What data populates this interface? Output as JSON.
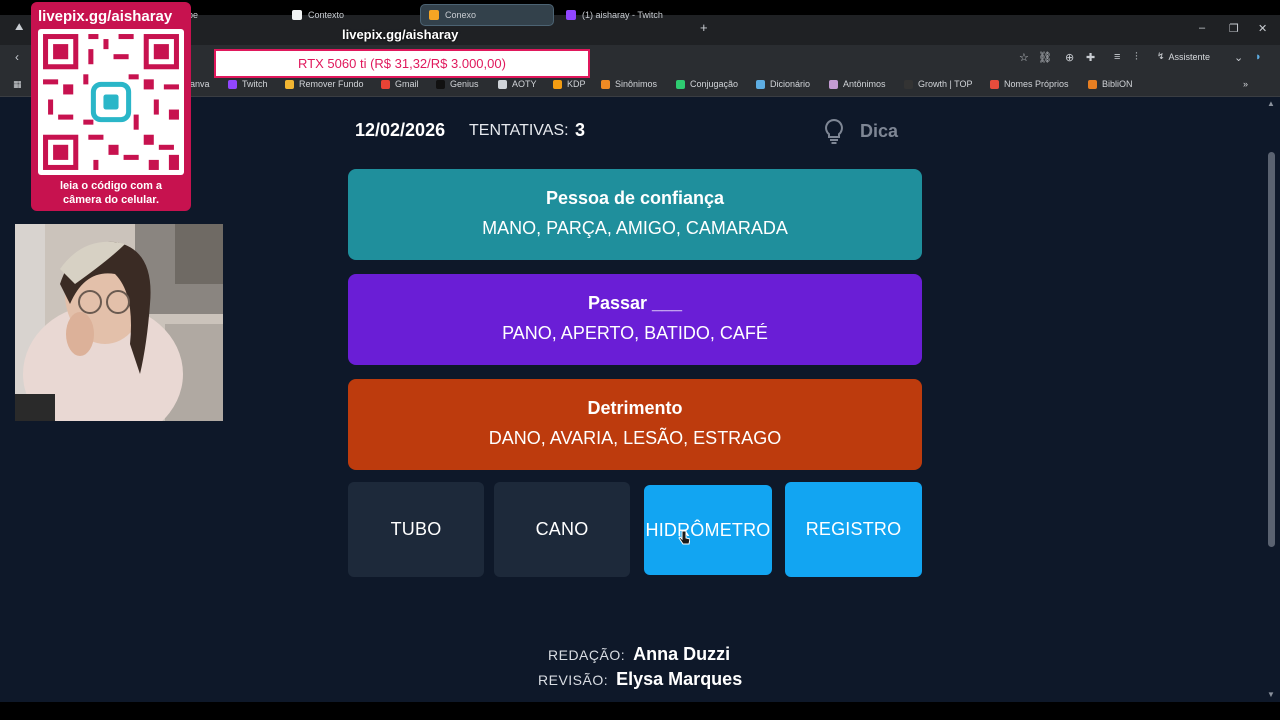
{
  "browser": {
    "tabs": [
      {
        "label": "be",
        "color": "#2b2f33"
      },
      {
        "label": "Contexto",
        "color": "#f1f3f4"
      },
      {
        "label": "Conexo",
        "color": "#f5a524"
      },
      {
        "label": "(1) aisharay - Twitch",
        "color": "#9146ff"
      }
    ],
    "new_tab": "+",
    "window_controls": {
      "minimize": "–",
      "restore": "❐",
      "close": "✕"
    },
    "assistant_label": "Assistente",
    "bookmarks": [
      {
        "label": "anva",
        "color": "#1e88e5"
      },
      {
        "label": "Twitch",
        "color": "#9146ff"
      },
      {
        "label": "Remover Fundo",
        "color": "#f2b632"
      },
      {
        "label": "Gmail",
        "color": "#ea4335"
      },
      {
        "label": "Genius",
        "color": "#111111"
      },
      {
        "label": "AOTY",
        "color": "#cfd3d8"
      },
      {
        "label": "KDP",
        "color": "#f39c12"
      },
      {
        "label": "Sinônimos",
        "color": "#f08a24"
      },
      {
        "label": "Conjugação",
        "color": "#2ecc71"
      },
      {
        "label": "Dicionário",
        "color": "#5dade2"
      },
      {
        "label": "Antônimos",
        "color": "#c39bd3"
      },
      {
        "label": "Growth | TOP",
        "color": "#333333"
      },
      {
        "label": "Nomes Próprios",
        "color": "#e74c3c"
      },
      {
        "label": "BibliON",
        "color": "#e67e22"
      }
    ],
    "more_bookmarks": "»"
  },
  "game": {
    "date": "12/02/2026",
    "tries_label": "TENTATIVAS:",
    "tries_value": "3",
    "hint_label": "Dica",
    "groups": [
      {
        "title": "Pessoa de confiança",
        "words": "MANO, PARÇA, AMIGO, CAMARADA",
        "color": "#1f8f9c"
      },
      {
        "title": "Passar ___",
        "words": "PANO, APERTO, BATIDO, CAFÉ",
        "color": "#6a1ed6"
      },
      {
        "title": "Detrimento",
        "words": "DANO, AVARIA, LESÃO, ESTRAGO",
        "color": "#bd3b0d"
      }
    ],
    "tiles": [
      {
        "label": "TUBO",
        "selected": false
      },
      {
        "label": "CANO",
        "selected": false
      },
      {
        "label": "HIDRÔMETRO",
        "selected": true
      },
      {
        "label": "REGISTRO",
        "selected": true
      }
    ],
    "credits": [
      {
        "label": "REDAÇÃO:",
        "name": "Anna Duzzi"
      },
      {
        "label": "REVISÃO:",
        "name": "Elysa Marques"
      }
    ]
  },
  "overlay": {
    "qr_title": "livepix.gg/aisharay",
    "qr_caption_line1": "leia o código com a",
    "qr_caption_line2": "câmera do celular.",
    "pix_url": "livepix.gg/aisharay",
    "goal_banner": "RTX 5060 ti (R$ 31,32/R$ 3.000,00)"
  }
}
